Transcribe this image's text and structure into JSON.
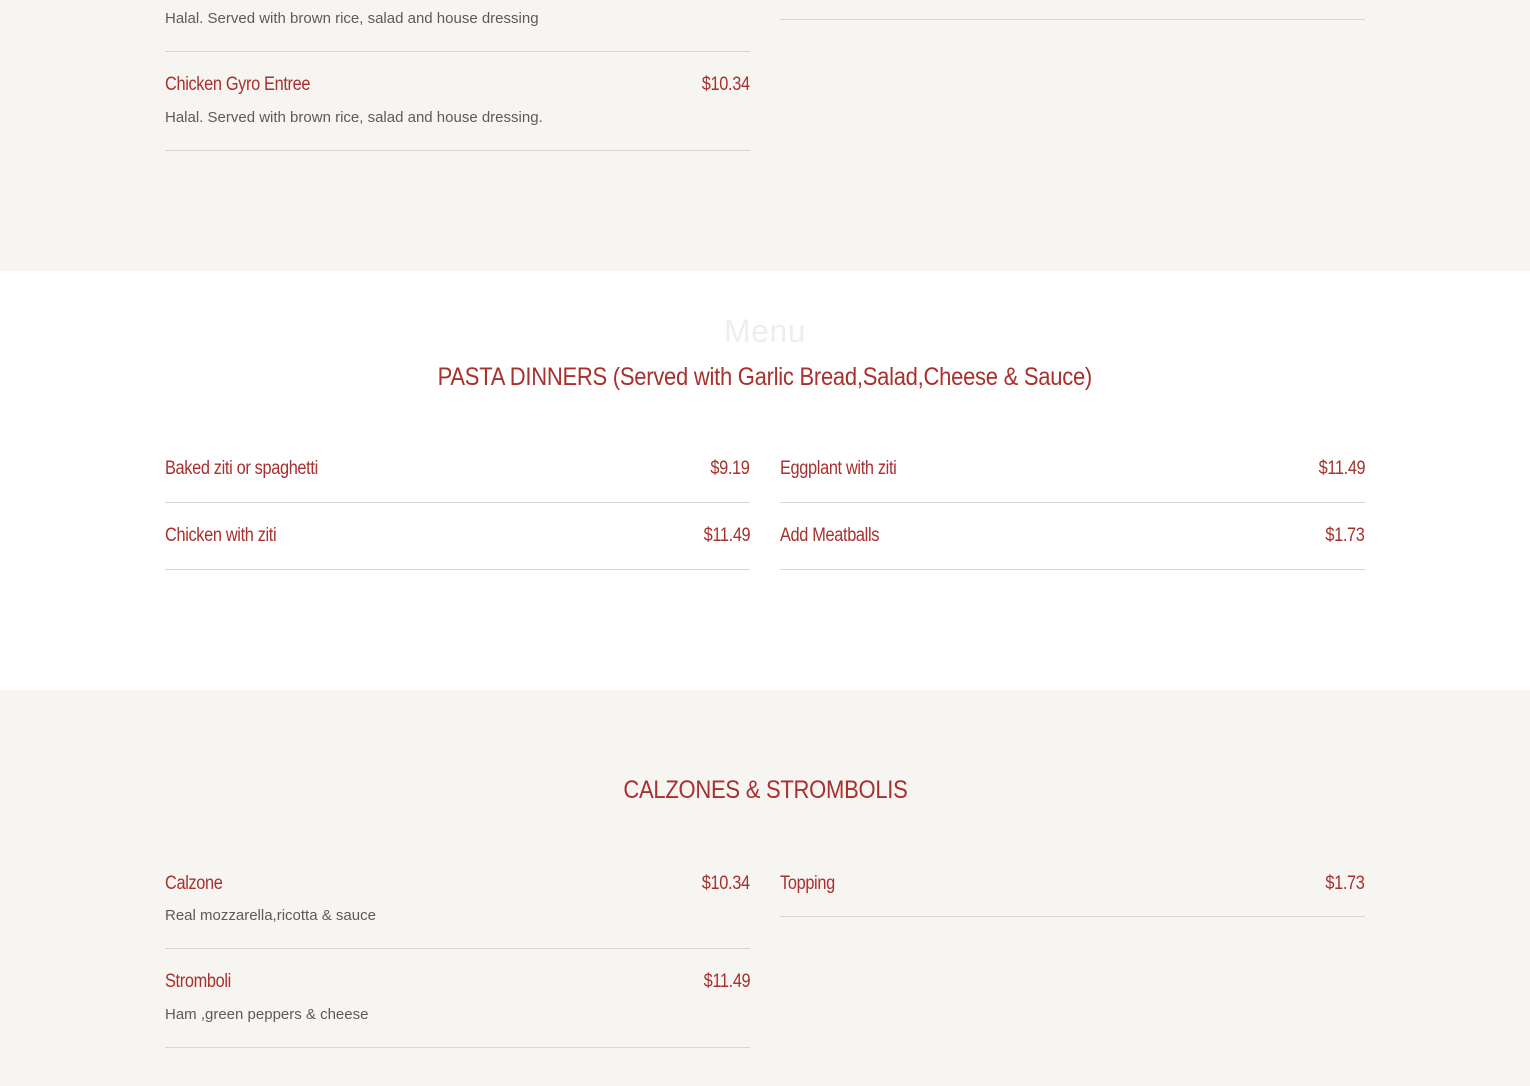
{
  "top_section": {
    "left_items": [
      {
        "desc": "Halal. Served with brown rice, salad and house dressing"
      },
      {
        "name": "Chicken Gyro Entree",
        "price": "$10.34",
        "desc": "Halal. Served with brown rice, salad and house dressing."
      }
    ]
  },
  "pasta_section": {
    "kicker": "Menu",
    "title": "PASTA DINNERS (Served with Garlic Bread,Salad,Cheese & Sauce)",
    "left_items": [
      {
        "name": "Baked ziti or spaghetti",
        "price": "$9.19"
      },
      {
        "name": "Chicken with ziti",
        "price": "$11.49"
      }
    ],
    "right_items": [
      {
        "name": "Eggplant with ziti",
        "price": "$11.49"
      },
      {
        "name": "Add Meatballs",
        "price": "$1.73"
      }
    ]
  },
  "calzones_section": {
    "title": "CALZONES & STROMBOLIS",
    "left_items": [
      {
        "name": "Calzone",
        "price": "$10.34",
        "desc": "Real mozzarella,ricotta & sauce"
      },
      {
        "name": "Stromboli",
        "price": "$11.49",
        "desc": "Ham ,green peppers & cheese"
      }
    ],
    "right_items": [
      {
        "name": "Topping",
        "price": "$1.73"
      }
    ]
  },
  "colors": {
    "accent": "#a8302d",
    "text_muted": "#5d5a57",
    "bg_alt": "#f7f5f2",
    "bg_white": "#ffffff",
    "divider": "#d9d6d2"
  }
}
